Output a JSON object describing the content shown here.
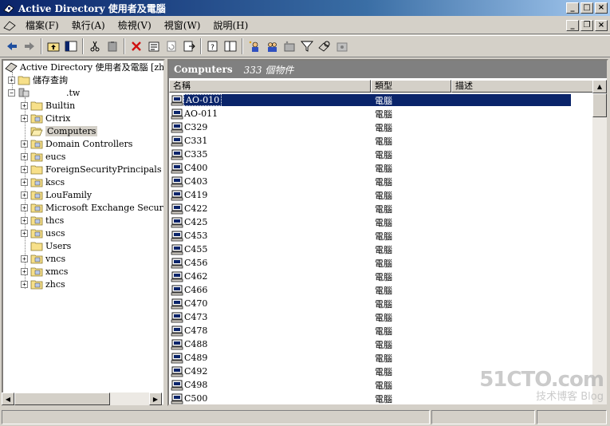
{
  "window": {
    "title": "Active Directory 使用者及電腦"
  },
  "menu": [
    {
      "label": "檔案(F)"
    },
    {
      "label": "執行(A)"
    },
    {
      "label": "檢視(V)"
    },
    {
      "label": "視窗(W)"
    },
    {
      "label": "說明(H)"
    }
  ],
  "tree": {
    "root_label": "Active Directory 使用者及電腦 [zhcs",
    "saved_queries_label": "儲存查詢",
    "domain_label": ".tw",
    "items": [
      {
        "label": "Builtin",
        "type": "folder"
      },
      {
        "label": "Citrix",
        "type": "ou"
      },
      {
        "label": "Computers",
        "type": "folder-open",
        "selected": true
      },
      {
        "label": "Domain Controllers",
        "type": "ou"
      },
      {
        "label": "eucs",
        "type": "ou"
      },
      {
        "label": "ForeignSecurityPrincipals",
        "type": "folder"
      },
      {
        "label": "kscs",
        "type": "ou"
      },
      {
        "label": "LouFamily",
        "type": "ou"
      },
      {
        "label": "Microsoft Exchange Security (",
        "type": "ou"
      },
      {
        "label": "thcs",
        "type": "ou"
      },
      {
        "label": "uscs",
        "type": "ou"
      },
      {
        "label": "Users",
        "type": "folder"
      },
      {
        "label": "vncs",
        "type": "ou"
      },
      {
        "label": "xmcs",
        "type": "ou"
      },
      {
        "label": "zhcs",
        "type": "ou"
      }
    ]
  },
  "details": {
    "title": "Computers",
    "count": "333 個物件",
    "columns": {
      "name": "名稱",
      "type": "類型",
      "desc": "描述"
    },
    "rows": [
      {
        "name": "AO-010",
        "type": "電腦"
      },
      {
        "name": "AO-011",
        "type": "電腦"
      },
      {
        "name": "C329",
        "type": "電腦"
      },
      {
        "name": "C331",
        "type": "電腦"
      },
      {
        "name": "C335",
        "type": "電腦"
      },
      {
        "name": "C400",
        "type": "電腦"
      },
      {
        "name": "C403",
        "type": "電腦"
      },
      {
        "name": "C419",
        "type": "電腦"
      },
      {
        "name": "C422",
        "type": "電腦"
      },
      {
        "name": "C425",
        "type": "電腦"
      },
      {
        "name": "C453",
        "type": "電腦"
      },
      {
        "name": "C455",
        "type": "電腦"
      },
      {
        "name": "C456",
        "type": "電腦"
      },
      {
        "name": "C462",
        "type": "電腦"
      },
      {
        "name": "C466",
        "type": "電腦"
      },
      {
        "name": "C470",
        "type": "電腦"
      },
      {
        "name": "C473",
        "type": "電腦"
      },
      {
        "name": "C478",
        "type": "電腦"
      },
      {
        "name": "C488",
        "type": "電腦"
      },
      {
        "name": "C489",
        "type": "電腦"
      },
      {
        "name": "C492",
        "type": "電腦"
      },
      {
        "name": "C498",
        "type": "電腦"
      },
      {
        "name": "C500",
        "type": "電腦"
      }
    ]
  },
  "watermark": {
    "line1": "51CTO.com",
    "line2": "技术博客",
    "line3": "Blog"
  },
  "colors": {
    "title_bar_start": "#0a246a",
    "selection": "#0a246a",
    "face": "#d4d0c8"
  }
}
